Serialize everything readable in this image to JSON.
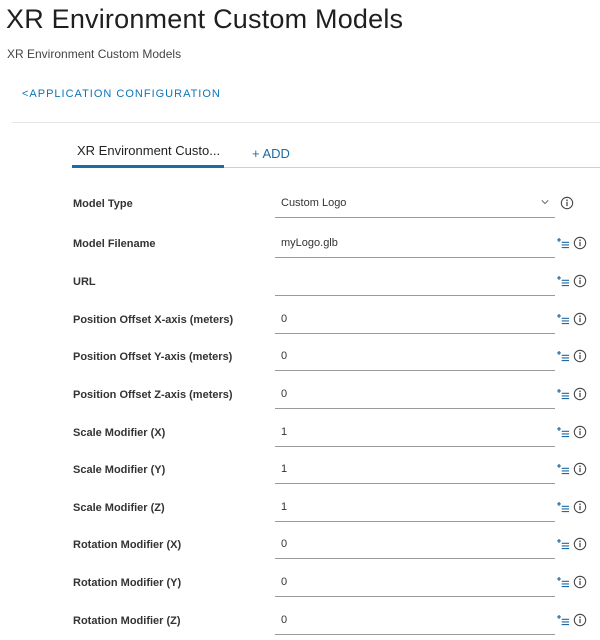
{
  "page": {
    "title": "XR Environment Custom Models",
    "subtitle": "XR Environment Custom Models",
    "back_link": "<APPLICATION CONFIGURATION"
  },
  "tabs": {
    "active_label": "XR Environment Custo...",
    "add_label": "+ ADD"
  },
  "accent_color": "#1d6aa5",
  "link_color": "#0b76b8",
  "form": {
    "model_type": {
      "label": "Model Type",
      "value": "Custom Logo"
    },
    "fields": [
      {
        "label": "Model Filename",
        "value": "myLogo.glb"
      },
      {
        "label": "URL",
        "value": ""
      },
      {
        "label": "Position Offset X-axis (meters)",
        "value": "0"
      },
      {
        "label": "Position Offset Y-axis (meters)",
        "value": "0"
      },
      {
        "label": "Position Offset Z-axis (meters)",
        "value": "0"
      },
      {
        "label": "Scale Modifier (X)",
        "value": "1"
      },
      {
        "label": "Scale Modifier (Y)",
        "value": "1"
      },
      {
        "label": "Scale Modifier (Z)",
        "value": "1"
      },
      {
        "label": "Rotation Modifier (X)",
        "value": "0"
      },
      {
        "label": "Rotation Modifier (Y)",
        "value": "0"
      },
      {
        "label": "Rotation Modifier (Z)",
        "value": "0"
      }
    ]
  },
  "icons": {
    "chevron": "chevron-down-icon",
    "list": "add-list-icon",
    "info": "info-icon"
  }
}
